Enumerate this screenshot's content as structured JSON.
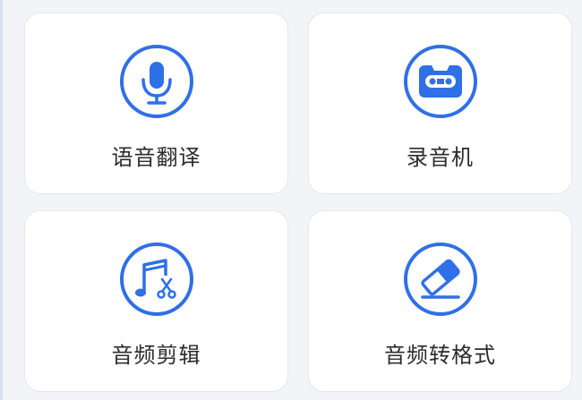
{
  "accent": "#2f6fe8",
  "tools": [
    {
      "label": "语音翻译",
      "icon": "microphone-icon"
    },
    {
      "label": "录音机",
      "icon": "cassette-tape-icon"
    },
    {
      "label": "音频剪辑",
      "icon": "music-scissors-icon"
    },
    {
      "label": "音频转格式",
      "icon": "eraser-icon"
    }
  ]
}
